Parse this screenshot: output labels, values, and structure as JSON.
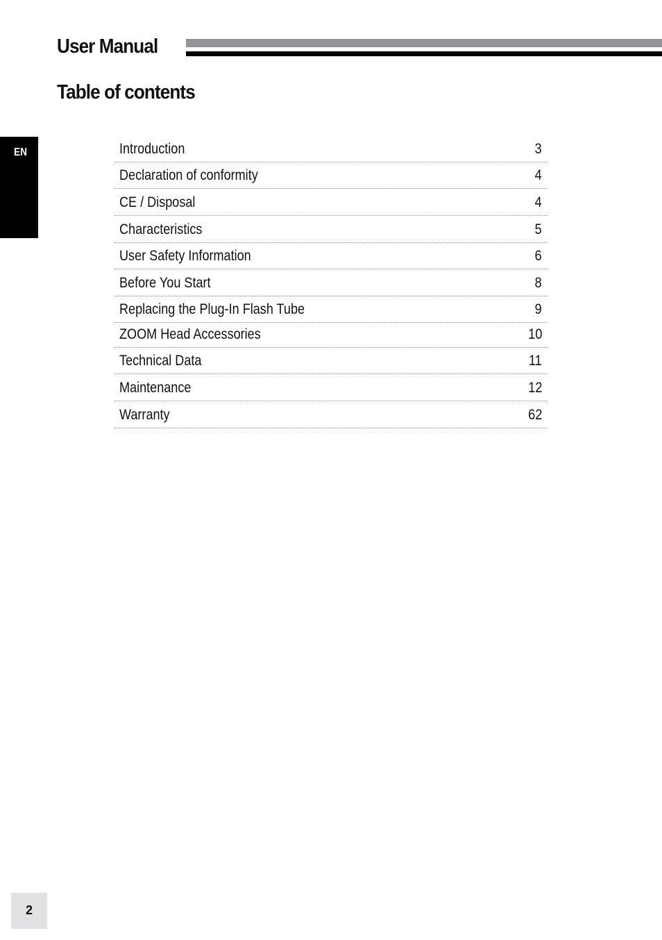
{
  "header": {
    "title": "User Manual",
    "bar_colors": {
      "top": "#939598",
      "bottom": "#000000"
    }
  },
  "toc": {
    "title": "Table of contents",
    "entries": [
      {
        "label": "Introduction",
        "page": "3"
      },
      {
        "label": "Declaration of conformity",
        "page": "4"
      },
      {
        "label": "CE / Disposal",
        "page": "4"
      },
      {
        "label": "Characteristics",
        "page": "5"
      },
      {
        "label": "User Safety Information",
        "page": "6"
      },
      {
        "label": "Before You Start",
        "page": "8"
      },
      {
        "label": "Replacing the Plug-In Flash Tube",
        "page": "9"
      },
      {
        "label": "ZOOM Head Accessories",
        "page": "10"
      },
      {
        "label": "Technical Data",
        "page": "11"
      },
      {
        "label": "Maintenance",
        "page": "12"
      },
      {
        "label": "Warranty",
        "page": "62"
      }
    ]
  },
  "language_tab": {
    "label": "EN"
  },
  "footer": {
    "page_number": "2"
  }
}
